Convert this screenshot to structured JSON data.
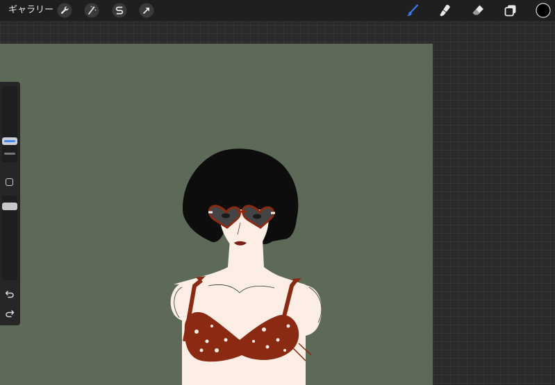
{
  "topbar": {
    "gallery_label": "ギャラリー",
    "left_tools": [
      "wrench-icon",
      "magic-wand-icon",
      "selection-s-icon",
      "transform-arrow-icon"
    ],
    "right_tools": [
      "brush-icon",
      "smudge-icon",
      "eraser-icon",
      "layers-icon",
      "color-swatch"
    ],
    "active_tool_color": "#3b7bf0",
    "current_color": "#000000"
  },
  "sidebar": {
    "controls": [
      "brush-size-slider",
      "modify-button",
      "opacity-slider",
      "undo-icon",
      "redo-icon"
    ]
  },
  "canvas": {
    "background_color": "#5e6a58"
  }
}
